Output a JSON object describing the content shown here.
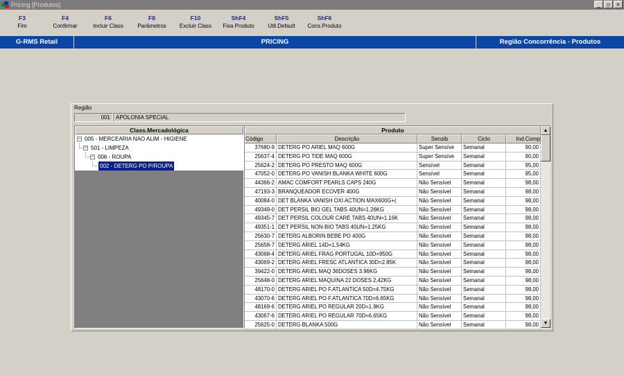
{
  "window": {
    "title": "Pricing [Produtos]",
    "buttons": [
      "_",
      "▫",
      "×"
    ]
  },
  "toolbar": [
    {
      "key": "F3",
      "label": "Fim"
    },
    {
      "key": "F4",
      "label": "Confirmar"
    },
    {
      "key": "F6",
      "label": "Incluir Class"
    },
    {
      "key": "F8",
      "label": "Parâmetros"
    },
    {
      "key": "F10",
      "label": "Excluir Class"
    },
    {
      "key": "ShF4",
      "label": "Fixa Produto"
    },
    {
      "key": "ShF5",
      "label": "Util.Default"
    },
    {
      "key": "ShF6",
      "label": "Cons.Produto"
    }
  ],
  "header_bar": {
    "left": "G-RMS Retail",
    "center": "PRICING",
    "right": "Região Concorrência - Produtos"
  },
  "regiao": {
    "label": "Região",
    "code": "001",
    "name": "APOLONIA SPECIAL"
  },
  "tree": {
    "header": "Class.Mercadológica",
    "nodes": [
      {
        "label": "005 - MERCEARIA NAO ALIM - HIGIENE",
        "expander": "−"
      },
      {
        "label": "501 - LIMPEZA",
        "expander": "−"
      },
      {
        "label": "006 - ROUPA",
        "expander": "−"
      },
      {
        "label": "002 - DETERG PO P/ROUPA",
        "expander": ""
      }
    ]
  },
  "grid": {
    "title": "Produto",
    "columns": [
      "Código",
      "Descrição",
      "Sensib",
      "Ciclo",
      "Ind.Comp"
    ],
    "rows": [
      [
        "37680-9",
        "DETERG PO ARIEL MAQ 600G",
        "Super Sensíve",
        "Semanal",
        "90,00"
      ],
      [
        "25637-4",
        "DETERG PO TIDE MAQ 600G",
        "Super Sensíve",
        "Semanal",
        "90,00"
      ],
      [
        "25624-2",
        "DETERG PO PRESTO MAQ 600G",
        "Sensível",
        "Semanal",
        "95,00"
      ],
      [
        "47052-0",
        "DETERG PO VANISH BLANKA WHITE 600G",
        "Sensível",
        "Semanal",
        "95,00"
      ],
      [
        "44366-2",
        "AMAC COMFORT PEARLS CAPS 240G",
        "Não Sensível",
        "Semanal",
        "98,00"
      ],
      [
        "47193-3",
        "BRANQUEADOR ECOVER 400G",
        "Não Sensível",
        "Semanal",
        "98,00"
      ],
      [
        "40084-0",
        "DET BLANKA VANISH OXI ACTION MAX600G+(",
        "Não Sensível",
        "Semanal",
        "98,00"
      ],
      [
        "49349-0",
        "DET PERSIL BIO GEL TABS 40UN=1.26KG",
        "Não Sensível",
        "Semanal",
        "98,00"
      ],
      [
        "49345-7",
        "DET PERSIL COLOUR CARE TABS 40UN=1.16K",
        "Não Sensível",
        "Semanal",
        "98,00"
      ],
      [
        "49351-1",
        "DET PERSIL NON-BIO TABS 40UN=1.25KG",
        "Não Sensível",
        "Semanal",
        "98,00"
      ],
      [
        "25630-7",
        "DETERG ALBORIN BEBE PO 400G",
        "Não Sensível",
        "Semanal",
        "98,00"
      ],
      [
        "25658-7",
        "DETERG ARIEL 14D=1,54KG",
        "Não Sensível",
        "Semanal",
        "98,00"
      ],
      [
        "43068-4",
        "DETERG ARIEL FRAG PORTUGAL 10D=950G",
        "Não Sensível",
        "Semanal",
        "98,00"
      ],
      [
        "43069-2",
        "DETERG ARIEL FRESC ATLANTICA 30D=2.85K",
        "Não Sensível",
        "Semanal",
        "98,00"
      ],
      [
        "39422-0",
        "DETERG ARIEL MAQ 36DOSES 3.96KG",
        "Não Sensível",
        "Semanal",
        "98,00"
      ],
      [
        "25648-0",
        "DETERG ARIEL MAQUINA 22 DOSES 2,42KG",
        "Não Sensível",
        "Semanal",
        "98,00"
      ],
      [
        "48170-0",
        "DETERG ARIEL PO F.ATLANTICA 50D=4.75KG",
        "Não Sensível",
        "Semanal",
        "98,00"
      ],
      [
        "43070-6",
        "DETERG ARIEL PO F.ATLANTICA 70D=6.65KG",
        "Não Sensível",
        "Semanal",
        "98,00"
      ],
      [
        "48169-6",
        "DETERG ARIEL PO REGULAR 20D=1.9KG",
        "Não Sensível",
        "Semanal",
        "98,00"
      ],
      [
        "43067-6",
        "DETERG ARIEL PO REGULAR 70D=6.65KG",
        "Não Sensível",
        "Semanal",
        "98,00"
      ],
      [
        "25625-0",
        "DETERG BLANKA 500G",
        "Não Sensível",
        "Semanal",
        "98,00"
      ]
    ]
  },
  "icons": {
    "app": "app-icon",
    "scroll_up": "▲",
    "scroll_down": "▼"
  },
  "colors": {
    "brand_bar": "#0a46a8",
    "selection": "#0a1f8c",
    "function_key": "#1c2a8c"
  }
}
